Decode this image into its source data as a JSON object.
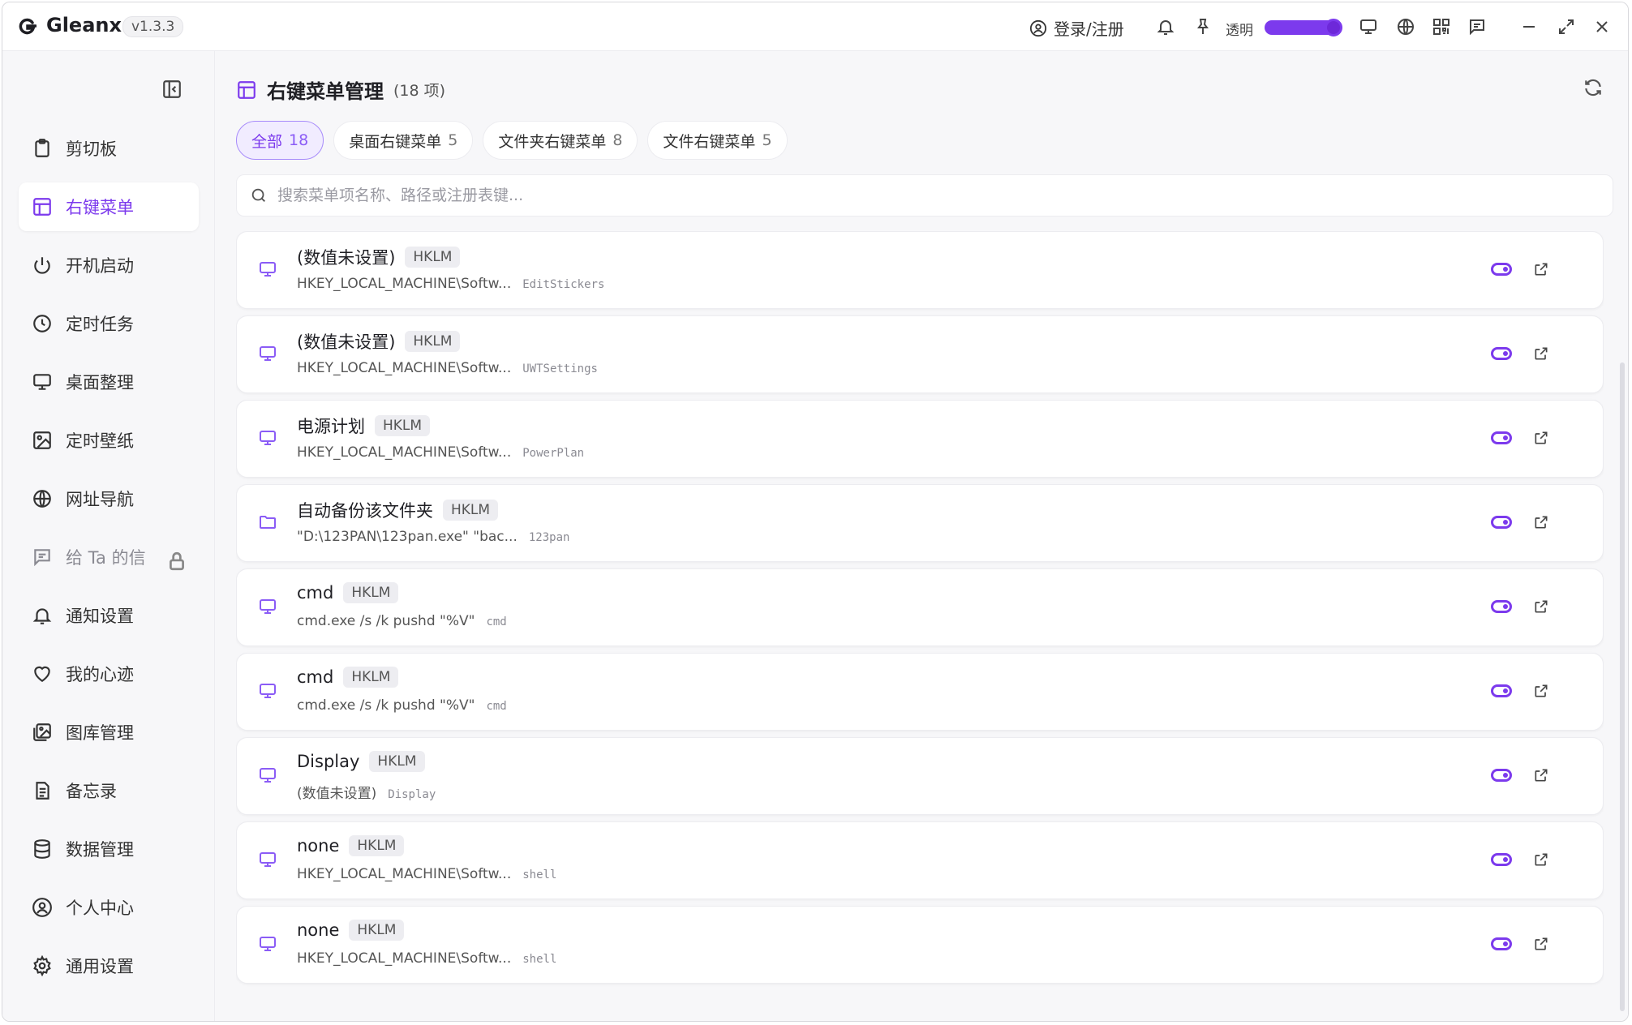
{
  "titlebar": {
    "app_name": "Gleanx",
    "version": "v1.3.3",
    "login_label": "登录/注册",
    "transparency_label": "透明",
    "transparency_level": 1.0
  },
  "sidebar": {
    "items": [
      {
        "label": "剪切板",
        "icon": "clipboard-icon"
      },
      {
        "label": "右键菜单",
        "icon": "layout-icon",
        "active": true
      },
      {
        "label": "开机启动",
        "icon": "power-icon"
      },
      {
        "label": "定时任务",
        "icon": "clock-icon"
      },
      {
        "label": "桌面整理",
        "icon": "monitor-icon"
      },
      {
        "label": "定时壁纸",
        "icon": "image-icon"
      },
      {
        "label": "网址导航",
        "icon": "globe-icon"
      },
      {
        "label": "给 Ta 的信",
        "icon": "message-icon",
        "locked": true
      },
      {
        "label": "通知设置",
        "icon": "bell-icon"
      },
      {
        "label": "我的心迹",
        "icon": "heart-icon"
      },
      {
        "label": "图库管理",
        "icon": "gallery-icon"
      },
      {
        "label": "备忘录",
        "icon": "note-icon"
      },
      {
        "label": "数据管理",
        "icon": "database-icon"
      },
      {
        "label": "个人中心",
        "icon": "user-icon"
      },
      {
        "label": "通用设置",
        "icon": "gear-icon"
      }
    ]
  },
  "main": {
    "title": "右键菜单管理",
    "count_text": "(18 项)",
    "tabs": [
      {
        "label": "全部",
        "count": "18",
        "active": true
      },
      {
        "label": "桌面右键菜单",
        "count": "5"
      },
      {
        "label": "文件夹右键菜单",
        "count": "8"
      },
      {
        "label": "文件右键菜单",
        "count": "5"
      }
    ],
    "search_placeholder": "搜索菜单项名称、路径或注册表键...",
    "rows": [
      {
        "name": "(数值未设置)",
        "badge": "HKLM",
        "path": "HKEY_LOCAL_MACHINE\\Softw...",
        "key": "EditStickers",
        "icon": "monitor-icon"
      },
      {
        "name": "(数值未设置)",
        "badge": "HKLM",
        "path": "HKEY_LOCAL_MACHINE\\Softw...",
        "key": "UWTSettings",
        "icon": "monitor-icon"
      },
      {
        "name": "电源计划",
        "badge": "HKLM",
        "path": "HKEY_LOCAL_MACHINE\\Softw...",
        "key": "PowerPlan",
        "icon": "monitor-icon"
      },
      {
        "name": "自动备份该文件夹",
        "badge": "HKLM",
        "path": "\"D:\\123PAN\\123pan.exe\" \"bac...",
        "key": "123pan",
        "icon": "folder-icon"
      },
      {
        "name": "cmd",
        "badge": "HKLM",
        "path": "cmd.exe /s /k pushd \"%V\"",
        "key": "cmd",
        "icon": "monitor-icon"
      },
      {
        "name": "cmd",
        "badge": "HKLM",
        "path": "cmd.exe /s /k pushd \"%V\"",
        "key": "cmd",
        "icon": "monitor-icon"
      },
      {
        "name": "Display",
        "badge": "HKLM",
        "path": "(数值未设置)",
        "key": "Display",
        "icon": "monitor-icon"
      },
      {
        "name": "none",
        "badge": "HKLM",
        "path": "HKEY_LOCAL_MACHINE\\Softw...",
        "key": "shell",
        "icon": "monitor-icon"
      },
      {
        "name": "none",
        "badge": "HKLM",
        "path": "HKEY_LOCAL_MACHINE\\Softw...",
        "key": "shell",
        "icon": "monitor-icon"
      }
    ]
  },
  "colors": {
    "accent": "#7c3aed",
    "accent_light": "#f1ecff"
  }
}
